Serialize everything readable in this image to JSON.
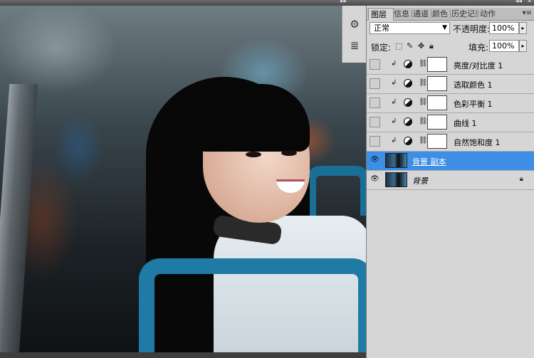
{
  "toolbar_top": {
    "left_arrows": "▸▸",
    "right_arrows": "◂◂",
    "close": "✕"
  },
  "panel": {
    "tabs": [
      {
        "label": "图层",
        "active": true
      },
      {
        "label": "信息",
        "active": false
      },
      {
        "label": "通道",
        "active": false
      },
      {
        "label": "颜色",
        "active": false
      },
      {
        "label": "历史记录",
        "active": false
      },
      {
        "label": "动作",
        "active": false
      }
    ],
    "menu_icon": "▾≡",
    "blend_mode": "正常",
    "opacity_label": "不透明度:",
    "opacity_value": "100%",
    "lock_label": "锁定:",
    "fill_label": "填充:",
    "fill_value": "100%",
    "layers": [
      {
        "name": "亮度/对比度 1",
        "type": "adjustment",
        "visible": false,
        "selected": false
      },
      {
        "name": "选取颜色 1",
        "type": "adjustment",
        "visible": false,
        "selected": false
      },
      {
        "name": "色彩平衡 1",
        "type": "adjustment",
        "visible": false,
        "selected": false
      },
      {
        "name": "曲线 1",
        "type": "adjustment",
        "visible": false,
        "selected": false
      },
      {
        "name": "自然饱和度 1",
        "type": "adjustment",
        "visible": false,
        "selected": false
      },
      {
        "name": "背景 副本",
        "type": "image",
        "visible": true,
        "selected": true
      },
      {
        "name": "背景",
        "type": "image",
        "visible": true,
        "selected": false,
        "locked": true
      }
    ]
  },
  "colors": {
    "selected_layer": "#3d8ee5",
    "panel_bg": "#d6d6d6",
    "seat_blue": "#1f7aa6"
  }
}
